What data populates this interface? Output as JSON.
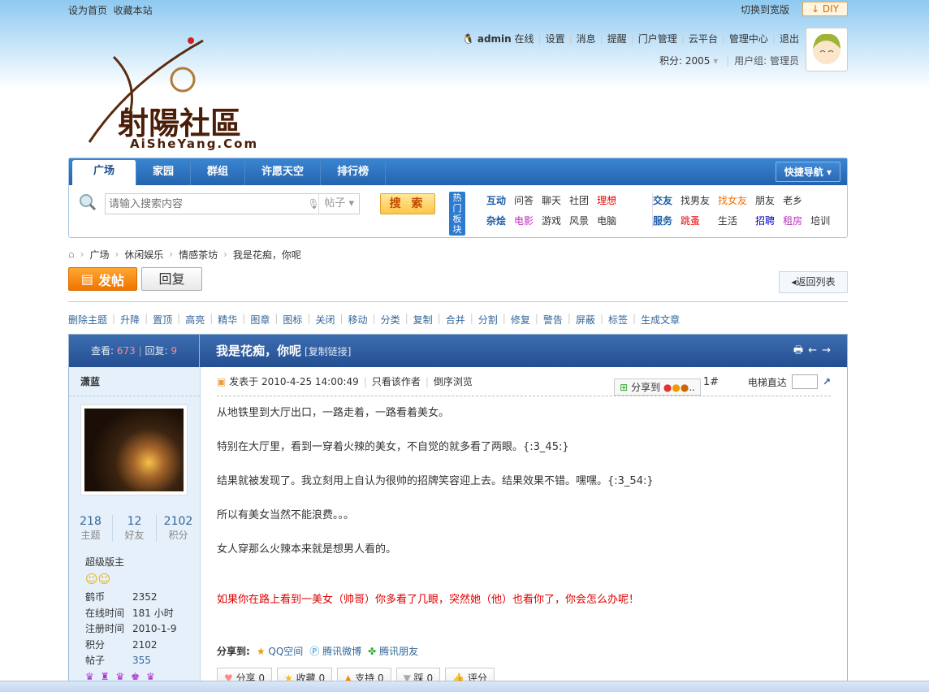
{
  "topbar": {
    "set_home": "设为首页",
    "bookmark": "收藏本站",
    "wide": "切换到宽版",
    "diy": "DIY"
  },
  "user": {
    "name": "admin",
    "status": "在线",
    "links": [
      "设置",
      "消息",
      "提醒",
      "门户管理",
      "云平台",
      "管理中心",
      "退出"
    ],
    "points_label": "积分: 2005",
    "group": "用户组: 管理员"
  },
  "logo": {
    "text": "射陽社區",
    "sub": "AiSheYang.Com"
  },
  "nav": {
    "tabs": [
      "广场",
      "家园",
      "群组",
      "许愿天空",
      "排行榜"
    ],
    "quick": "快捷导航"
  },
  "search": {
    "placeholder": "请输入搜索内容",
    "type": "帖子",
    "button": "搜 索"
  },
  "hot": {
    "label": "热门板块",
    "group1": [
      [
        "互动",
        "问答",
        "聊天",
        "社团",
        "理想"
      ],
      [
        "杂烩",
        "电影",
        "游戏",
        "风景",
        "电脑"
      ]
    ],
    "group2": [
      [
        "交友",
        "找男友",
        "找女友",
        "朋友",
        "老乡"
      ],
      [
        "服务",
        "跳蚤",
        "生活",
        "招聘",
        "租房",
        "培训"
      ]
    ]
  },
  "breadcrumb": [
    "广场",
    "休闲娱乐",
    "情感茶坊",
    "我是花痴，你呢"
  ],
  "buttons": {
    "post": "发帖",
    "reply": "回复",
    "back": "返回列表"
  },
  "mod_tools": [
    "删除主题",
    "升降",
    "置顶",
    "高亮",
    "精华",
    "图章",
    "图标",
    "关闭",
    "移动",
    "分类",
    "复制",
    "合并",
    "分割",
    "修复",
    "警告",
    "屏蔽",
    "标签",
    "生成文章"
  ],
  "thread": {
    "views_label": "查看:",
    "views": "673",
    "replies_label": "回复:",
    "replies": "9",
    "title": "我是花痴，你呢",
    "copy_link": "[复制链接]"
  },
  "author": {
    "name": "潇蓝",
    "stats": [
      {
        "v": "218",
        "l": "主题"
      },
      {
        "v": "12",
        "l": "好友"
      },
      {
        "v": "2102",
        "l": "积分"
      }
    ],
    "group": "超级版主",
    "profile": [
      [
        "鹤币",
        "2352"
      ],
      [
        "在线时间",
        "181 小时"
      ],
      [
        "注册时间",
        "2010-1-9"
      ],
      [
        "积分",
        "2102"
      ],
      [
        "帖子",
        "355"
      ]
    ]
  },
  "post": {
    "time": "发表于 2010-4-25 14:00:49",
    "only_author": "只看该作者",
    "reverse": "倒序浏览",
    "share": "分享到",
    "floor": "1#",
    "elevator": "电梯直达",
    "lines": [
      "从地铁里到大厅出口，一路走着，一路看着美女。",
      "特别在大厅里，看到一穿着火辣的美女，不自觉的就多看了两眼。{:3_45:}",
      "结果就被发现了。我立刻用上自认为很帅的招牌笑容迎上去。结果效果不错。嘿嘿。{:3_54:}",
      "所以有美女当然不能浪费。。。",
      "女人穿那么火辣本来就是想男人看的。"
    ],
    "red_line": "如果你在路上看到一美女（帅哥）你多看了几眼，突然她（他）也看你了，你会怎么办呢！",
    "share_to": "分享到:",
    "share_links": [
      "QQ空间",
      "腾讯微博",
      "腾讯朋友"
    ],
    "actions": [
      "分享 0",
      "收藏 0",
      "支持 0",
      "踩 0",
      "评分"
    ]
  },
  "colors": {
    "accent": "#2463b0",
    "red": "#e00000"
  }
}
